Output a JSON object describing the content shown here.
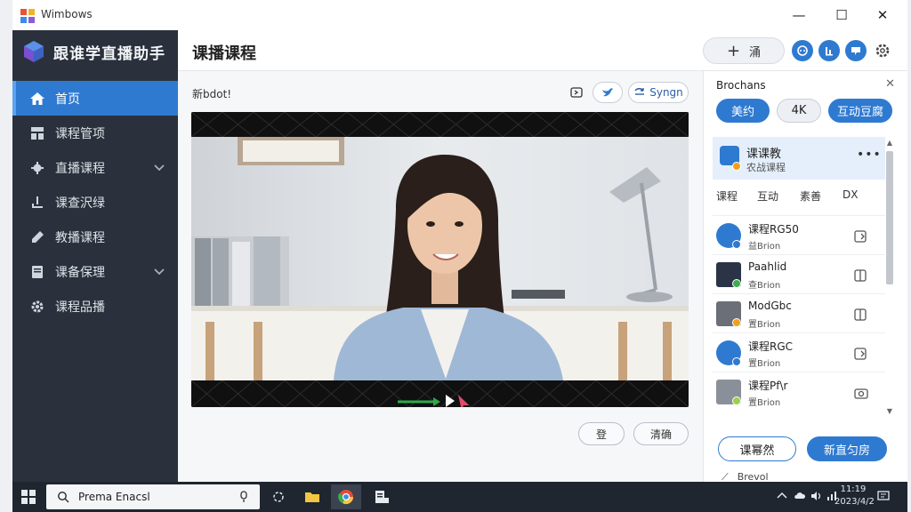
{
  "window": {
    "title": "Wimbows",
    "controls": {
      "minimize": "—",
      "maximize": "☐",
      "close": "✕"
    }
  },
  "sidebar": {
    "brand": "跟谁学直播助手",
    "items": [
      {
        "label": "首页",
        "icon": "home-icon",
        "active": true
      },
      {
        "label": "课程管项",
        "icon": "grid-icon"
      },
      {
        "label": "直播课程",
        "icon": "gear-icon",
        "expandable": true
      },
      {
        "label": "课查沢绿",
        "icon": "download-icon"
      },
      {
        "label": "教播课程",
        "icon": "pen-icon"
      },
      {
        "label": "课备保理",
        "icon": "document-icon",
        "expandable": true
      },
      {
        "label": "课程品播",
        "icon": "settings-icon"
      }
    ]
  },
  "header": {
    "title": "课播课程",
    "add_label": "涌",
    "icons": [
      "discord-icon",
      "chart-icon",
      "chat-icon",
      "settings-icon"
    ]
  },
  "main": {
    "label": "新bdot!",
    "sync_label": "Syngn",
    "buttons": {
      "secondary": "登",
      "primary": "清确"
    }
  },
  "panel": {
    "title": "Brochans",
    "chips": [
      "美约",
      "4K",
      "互动豆腐"
    ],
    "selected": {
      "title": "课课教",
      "subtitle": "农战课程"
    },
    "tabs": [
      "课程",
      "互动",
      "素善",
      "DX"
    ],
    "items": [
      {
        "title": "课程RG50",
        "subtitle": "益Brion",
        "thumb_color": "#2f7ad1",
        "badge_color": "#2f7ad1"
      },
      {
        "title": "Paahlid",
        "subtitle": "查Brion",
        "thumb_color": "#2a3446",
        "badge_color": "#3cae4c"
      },
      {
        "title": "ModGbc",
        "subtitle": "置Brion",
        "thumb_color": "#6a6f78",
        "badge_color": "#f0a020"
      },
      {
        "title": "课程RGC",
        "subtitle": "置Brion",
        "thumb_color": "#2f7ad1",
        "badge_color": "#2f7ad1"
      },
      {
        "title": "课程Pf\\r",
        "subtitle": "置Brion",
        "thumb_color": "#8a9099",
        "badge_color": "#9ad04a"
      }
    ],
    "buttons": {
      "left": "课幂然",
      "right": "新直匀房"
    },
    "footer": "Brevol"
  },
  "taskbar": {
    "search_text": "Prema Enacsl",
    "clock_time": "11:19",
    "clock_date": "2023/4/2"
  },
  "colors": {
    "accent": "#2f7ad1",
    "sidebar": "#2a313c",
    "taskbar": "#1f2630"
  }
}
